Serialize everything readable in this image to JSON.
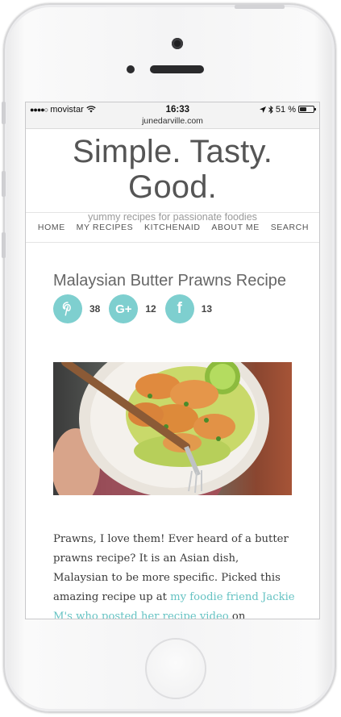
{
  "status": {
    "carrier": "movistar",
    "signal_dots": "●●●●○",
    "time": "16:33",
    "battery": "51 %",
    "battery_level": 0.51
  },
  "browser": {
    "url": "junedarville.com"
  },
  "site": {
    "title": "Simple. Tasty. Good.",
    "tagline": "yummy recipes for passionate foodies"
  },
  "nav": {
    "items": [
      "HOME",
      "MY RECIPES",
      "KITCHENAID",
      "ABOUT ME",
      "SEARCH"
    ]
  },
  "post": {
    "title": "Malaysian Butter Prawns Recipe",
    "share": [
      {
        "network": "pinterest",
        "glyph": "P",
        "count": "38"
      },
      {
        "network": "googleplus",
        "glyph": "G+",
        "count": "12"
      },
      {
        "network": "facebook",
        "glyph": "f",
        "count": "13"
      }
    ],
    "image_alt": "butter prawns on a plate",
    "body_text": "Prawns, I love them! Ever heard of a butter prawns recipe? It is an Asian dish, Malaysian to be more specific. Picked this amazing recipe up at ",
    "link_text": "my foodie friend Jackie M's who posted her recipe video",
    "body_after_link": " on"
  },
  "colors": {
    "accent": "#7ecfcf",
    "link": "#66c3c3"
  }
}
